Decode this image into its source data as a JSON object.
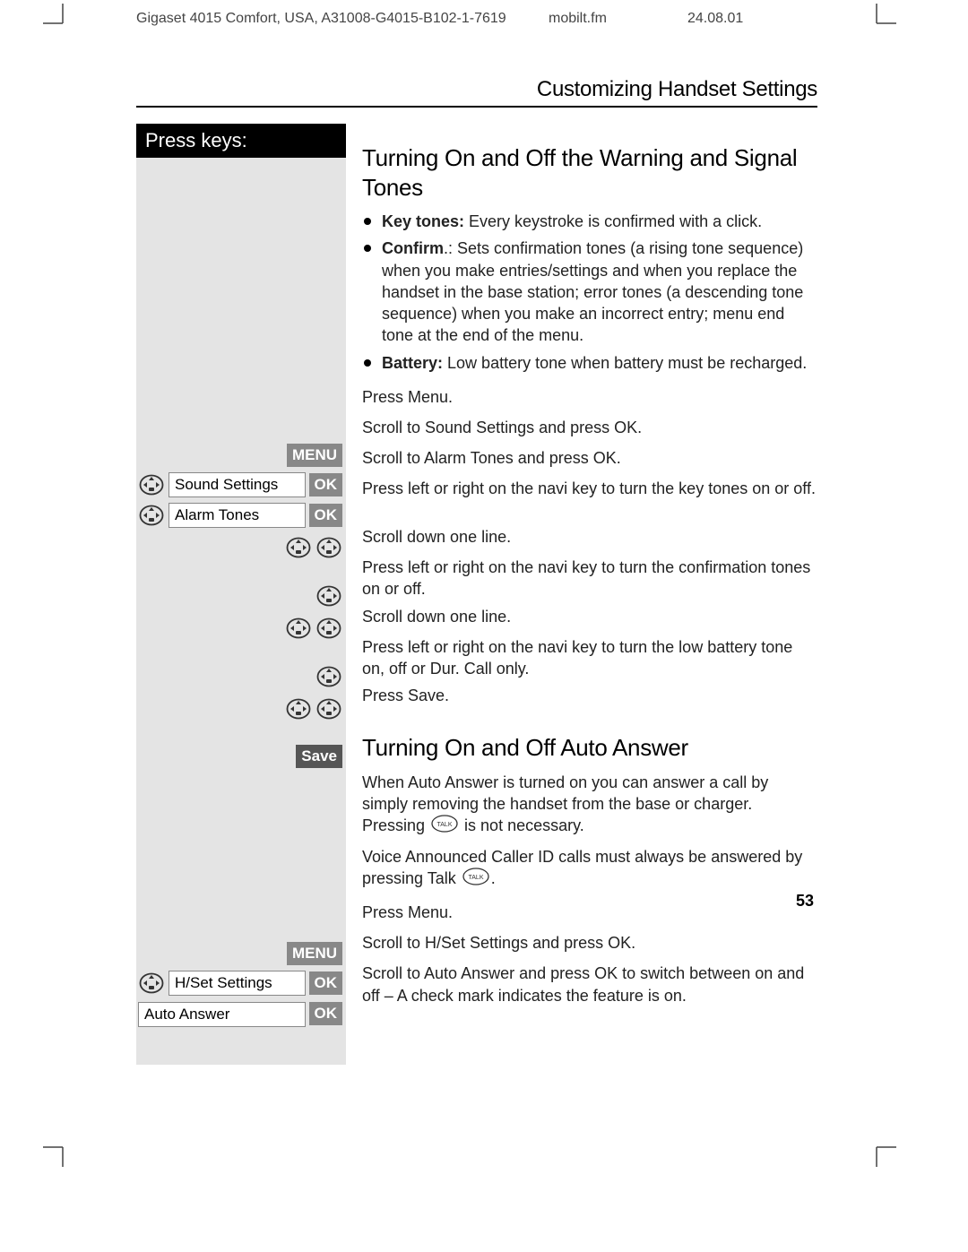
{
  "header": {
    "product": "Gigaset 4015 Comfort, USA, A31008-G4015-B102-1-7619",
    "file": "mobilt.fm",
    "date": "24.08.01"
  },
  "section_title": "Customizing Handset Settings",
  "press_keys_label": "Press keys:",
  "section1": {
    "title": "Turning On and Off the Warning and Signal Tones",
    "bullets": [
      {
        "bold": "Key tones:",
        "rest": " Every keystroke is confirmed with a click."
      },
      {
        "bold": "Confirm",
        "rest": ".: Sets confirmation tones (a rising tone sequence) when you make entries/settings and when you replace the handset in the base station; error tones (a descending tone sequence) when you make an incorrect entry; menu end tone at the end of the menu."
      },
      {
        "bold": "Battery:",
        "rest": " Low battery tone when battery must be recharged."
      }
    ],
    "steps": [
      {
        "left": {
          "type": "softkey",
          "label": "MENU"
        },
        "text": "Press Menu."
      },
      {
        "left": {
          "type": "menu",
          "nav": "single",
          "field": "Sound Settings",
          "ok": "OK"
        },
        "text": "Scroll to Sound Settings and press OK."
      },
      {
        "left": {
          "type": "menu",
          "nav": "single",
          "field": "Alarm Tones",
          "ok": "OK"
        },
        "text": "Scroll to Alarm Tones and press OK."
      },
      {
        "left": {
          "type": "nav",
          "nav": "double"
        },
        "text": "Press left or right on the navi key to turn the key tones on or off.",
        "tall": true
      },
      {
        "left": {
          "type": "nav",
          "nav": "single"
        },
        "text": "Scroll down one line."
      },
      {
        "left": {
          "type": "nav",
          "nav": "double"
        },
        "text": "Press left or right on the navi key to turn the confirmation tones on or off.",
        "tall": true
      },
      {
        "left": {
          "type": "nav",
          "nav": "single"
        },
        "text": "Scroll down one line."
      },
      {
        "left": {
          "type": "nav",
          "nav": "double"
        },
        "text": "Press left or right on the navi key to turn the low battery tone on, off or Dur. Call only.",
        "tall": true
      },
      {
        "left": {
          "type": "softkey",
          "label": "Save",
          "dark": true
        },
        "text": "Press Save."
      }
    ]
  },
  "section2": {
    "title": "Turning On and Off Auto Answer",
    "paras": [
      "When Auto Answer is turned on you can answer a call by simply removing the handset from the base or charger.  Pressing [TALK] is not necessary.",
      "Voice Announced Caller ID calls must always be answered by pressing Talk [TALK]."
    ],
    "steps": [
      {
        "left": {
          "type": "softkey",
          "label": "MENU"
        },
        "text": "Press Menu."
      },
      {
        "left": {
          "type": "menu",
          "nav": "single",
          "field": "H/Set Settings",
          "ok": "OK"
        },
        "text": "Scroll to H/Set Settings and press OK."
      },
      {
        "left": {
          "type": "menu",
          "nav": "none",
          "field": "Auto Answer",
          "ok": "OK"
        },
        "text": "Scroll to Auto Answer and press OK to switch between on and off – A check mark indicates the feature is on.",
        "tall": true
      }
    ]
  },
  "page_number": "53"
}
